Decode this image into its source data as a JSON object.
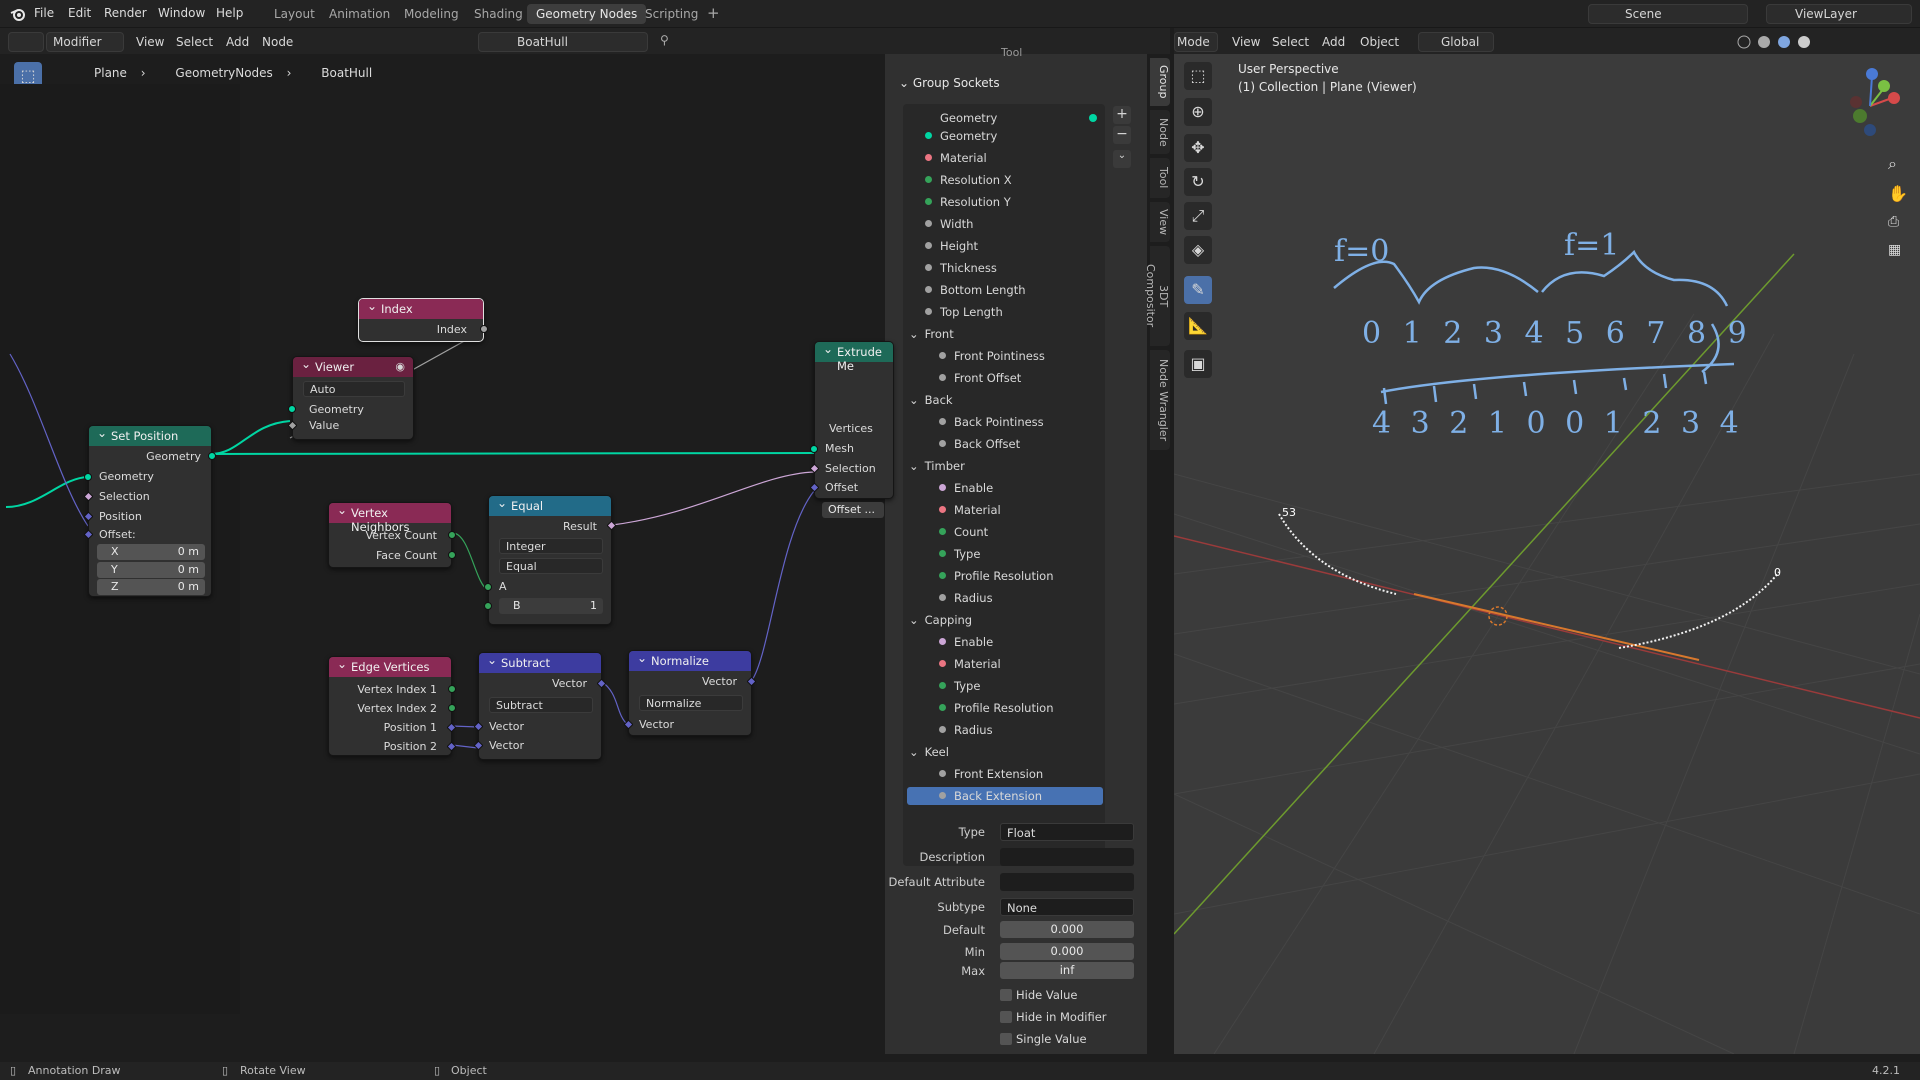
{
  "topbar": {
    "menu": [
      "File",
      "Edit",
      "Render",
      "Window",
      "Help"
    ],
    "workspaces": [
      "Layout",
      "Animation",
      "Modeling",
      "Shading",
      "Geometry Nodes",
      "Scripting"
    ],
    "active_workspace": "Geometry Nodes",
    "scene": "Scene",
    "view_layer": "ViewLayer"
  },
  "node_header": {
    "mode": "Modifier",
    "menus": [
      "View",
      "Select",
      "Add",
      "Node"
    ],
    "tree_name": "BoatHull"
  },
  "breadcrumb": [
    "Plane",
    "GeometryNodes",
    "BoatHull"
  ],
  "nodes": {
    "index": {
      "title": "Index",
      "out": "Index"
    },
    "viewer": {
      "title": "Viewer",
      "domain": "Auto",
      "in1": "Geometry",
      "in2": "Value"
    },
    "set_position": {
      "title": "Set Position",
      "out": "Geometry",
      "in": [
        "Geometry",
        "Selection",
        "Position",
        "Offset:"
      ],
      "x_label": "X",
      "x": "0 m",
      "y_label": "Y",
      "y": "0 m",
      "z_label": "Z",
      "z": "0 m"
    },
    "vertex_neighbors": {
      "title": "Vertex Neighbors",
      "out1": "Vertex Count",
      "out2": "Face Count"
    },
    "equal": {
      "title": "Equal",
      "out": "Result",
      "type": "Integer",
      "op": "Equal",
      "a": "A",
      "b_label": "B",
      "b": "1"
    },
    "extrude": {
      "title": "Extrude Me",
      "out": "Vertices",
      "in": [
        "Mesh",
        "Selection",
        "Offset",
        "Offset ..."
      ]
    },
    "edge_vertices": {
      "title": "Edge Vertices",
      "outs": [
        "Vertex Index 1",
        "Vertex Index 2",
        "Position 1",
        "Position 2"
      ]
    },
    "subtract": {
      "title": "Subtract",
      "out": "Vector",
      "op": "Subtract",
      "in1": "Vector",
      "in2": "Vector"
    },
    "normalize": {
      "title": "Normalize",
      "out": "Vector",
      "op": "Normalize",
      "in": "Vector"
    }
  },
  "sidebar": {
    "tool_label": "Tool",
    "panel_title": "Group Sockets",
    "output_socket": "Geometry",
    "items": [
      {
        "label": "Geometry",
        "color": "#00d6a3",
        "indent": 0
      },
      {
        "label": "Material",
        "color": "#eb7582",
        "indent": 0
      },
      {
        "label": "Resolution X",
        "color": "#35a35a",
        "indent": 0
      },
      {
        "label": "Resolution Y",
        "color": "#35a35a",
        "indent": 0
      },
      {
        "label": "Width",
        "color": "#a1a1a1",
        "indent": 0
      },
      {
        "label": "Height",
        "color": "#a1a1a1",
        "indent": 0
      },
      {
        "label": "Thickness",
        "color": "#a1a1a1",
        "indent": 0
      },
      {
        "label": "Bottom Length",
        "color": "#a1a1a1",
        "indent": 0
      },
      {
        "label": "Top Length",
        "color": "#a1a1a1",
        "indent": 0
      }
    ],
    "panels": [
      {
        "name": "Front",
        "items": [
          {
            "label": "Front Pointiness",
            "color": "#a1a1a1"
          },
          {
            "label": "Front Offset",
            "color": "#a1a1a1"
          }
        ]
      },
      {
        "name": "Back",
        "items": [
          {
            "label": "Back Pointiness",
            "color": "#a1a1a1"
          },
          {
            "label": "Back Offset",
            "color": "#a1a1a1"
          }
        ]
      },
      {
        "name": "Timber",
        "items": [
          {
            "label": "Enable",
            "color": "#cca6d6"
          },
          {
            "label": "Material",
            "color": "#eb7582"
          },
          {
            "label": "Count",
            "color": "#35a35a"
          },
          {
            "label": "Type",
            "color": "#35a35a"
          },
          {
            "label": "Profile Resolution",
            "color": "#35a35a"
          },
          {
            "label": "Radius",
            "color": "#a1a1a1"
          }
        ]
      },
      {
        "name": "Capping",
        "items": [
          {
            "label": "Enable",
            "color": "#cca6d6"
          },
          {
            "label": "Material",
            "color": "#eb7582"
          },
          {
            "label": "Type",
            "color": "#35a35a"
          },
          {
            "label": "Profile Resolution",
            "color": "#35a35a"
          },
          {
            "label": "Radius",
            "color": "#a1a1a1"
          }
        ]
      },
      {
        "name": "Keel",
        "items": [
          {
            "label": "Front Extension",
            "color": "#a1a1a1"
          },
          {
            "label": "Back Extension",
            "color": "#a1a1a1"
          }
        ]
      }
    ],
    "selected": "Back Extension",
    "props": {
      "type_label": "Type",
      "type": "Float",
      "desc_label": "Description",
      "desc": "",
      "attr_label": "Default Attribute",
      "attr": "",
      "subtype_label": "Subtype",
      "subtype": "None",
      "default_label": "Default",
      "default": "0.000",
      "min_label": "Min",
      "min": "0.000",
      "max_label": "Max",
      "max": "inf",
      "hide_value": "Hide Value",
      "hide_modifier": "Hide in Modifier",
      "single_value": "Single Value"
    },
    "vtabs": [
      "Group",
      "Node",
      "Tool",
      "View",
      "3DT Compositor",
      "Node Wrangler"
    ]
  },
  "viewport": {
    "header": {
      "mode": "Mode",
      "menus": [
        "View",
        "Select",
        "Add",
        "Object"
      ],
      "orientation": "Global"
    },
    "overlay1": "User Perspective",
    "overlay2": "(1) Collection | Plane (Viewer)",
    "annot_f0": "f=0",
    "annot_f1": "f=1",
    "annot_row1": "0 1 2 3 4 5 6 7 8 9",
    "annot_row2": "4 3 2 1 0 0 1 2 3 4",
    "index_labels_left": "53",
    "index_labels_right": "0"
  },
  "status": {
    "left": "Annotation Draw",
    "mid": "Rotate View",
    "obj": "Object",
    "version": "4.2.1"
  }
}
